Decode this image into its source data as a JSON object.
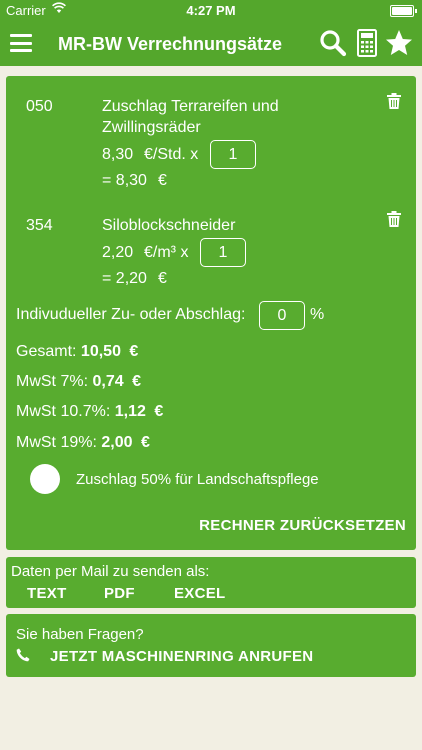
{
  "status_bar": {
    "carrier": "Carrier",
    "time": "4:27 PM"
  },
  "nav": {
    "title": "MR-BW Verrechnungsätze",
    "icons": [
      "menu-icon",
      "search-icon",
      "calculator-icon",
      "star-icon"
    ]
  },
  "items": [
    {
      "code": "050",
      "name_line1": "Zuschlag Terrareifen und",
      "name_line2": "Zwillingsräder",
      "price": "8,30",
      "unit": "€/Std. x",
      "quantity": "1",
      "total": "= 8,30",
      "total_unit": "€"
    },
    {
      "code": "354",
      "name_line1": "Siloblockschneider",
      "price": "2,20",
      "unit": "€/m³ x",
      "quantity": "1",
      "total": "= 2,20",
      "total_unit": "€"
    }
  ],
  "adjustment": {
    "label": "Indivudueller Zu- oder Abschlag:",
    "value": "0",
    "unit": "%"
  },
  "totals": {
    "gesamt_label": "Gesamt:",
    "gesamt_value": "10,50",
    "gesamt_unit": "€",
    "mwst7_label": "MwSt 7%:",
    "mwst7_value": "0,74",
    "mwst7_unit": "€",
    "mwst107_label": "MwSt 10.7%:",
    "mwst107_value": "1,12",
    "mwst107_unit": "€",
    "mwst19_label": "MwSt 19%:",
    "mwst19_value": "2,00",
    "mwst19_unit": "€"
  },
  "surcharge_toggle": {
    "label": "Zuschlag 50% für Landschaftspflege",
    "checked": false
  },
  "reset_label": "RECHNER ZURÜCKSETZEN",
  "mail": {
    "heading": "Daten per Mail zu senden als:",
    "text_label": "TEXT",
    "pdf_label": "PDF",
    "excel_label": "EXCEL"
  },
  "contact": {
    "heading": "Sie haben Fragen?",
    "call_label": "JETZT MASCHINENRING ANRUFEN"
  },
  "colors": {
    "accent": "#54a72c",
    "card": "#58ac2f",
    "background": "#f2efe3"
  }
}
